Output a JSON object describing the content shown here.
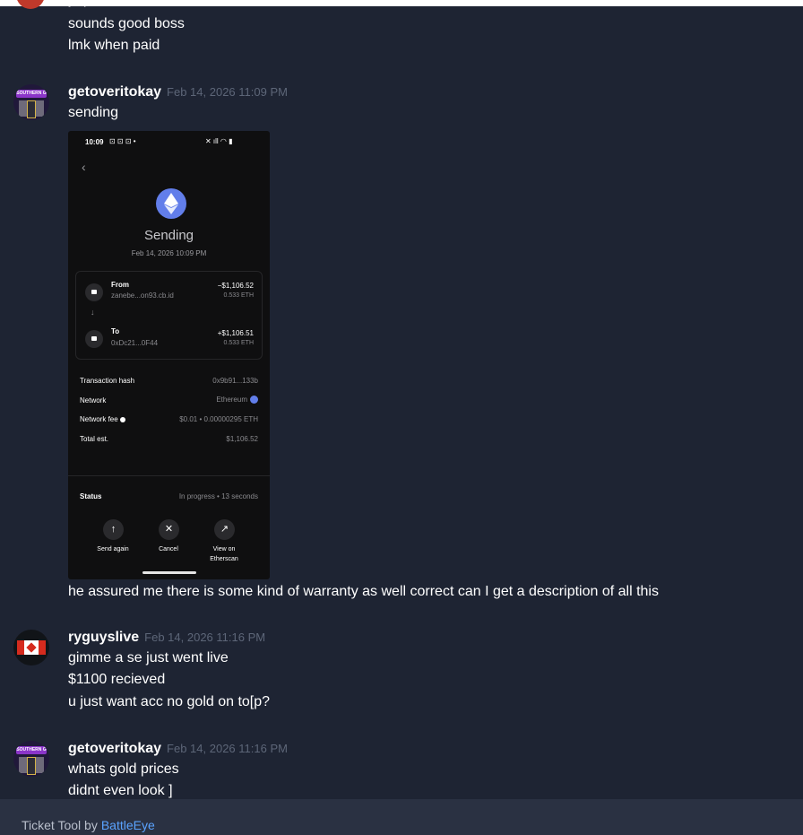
{
  "prev_message": {
    "partial_text": "yep",
    "lines": [
      "sounds good boss",
      "lmk when paid"
    ]
  },
  "messages": [
    {
      "username": "getoveritokay",
      "timestamp": "Feb 14, 2026 11:09 PM",
      "avatar_text": "SOUTHERN G",
      "lines": [
        "sending"
      ],
      "after_image": "he assured me there is some kind of warranty as well correct can I get a description of all this"
    },
    {
      "username": "ryguyslive",
      "timestamp": "Feb 14, 2026 11:16 PM",
      "lines": [
        "gimme a se just went live",
        "$1100 recieved",
        "u just want acc no gold on to[p?"
      ]
    },
    {
      "username": "getoveritokay",
      "timestamp": "Feb 14, 2026 11:16 PM",
      "avatar_text": "SOUTHERN G",
      "lines": [
        "whats gold prices",
        "didnt even look ]"
      ]
    }
  ],
  "attachment": {
    "status_time": "10:09",
    "title": "Sending",
    "date": "Feb 14, 2026 10:09 PM",
    "from": {
      "label": "From",
      "address": "zanebe...on93.cb.id",
      "usd": "−$1,106.52",
      "eth": "0.533 ETH"
    },
    "to": {
      "label": "To",
      "address": "0xDc21...0F44",
      "usd": "+$1,106.51",
      "eth": "0.533 ETH"
    },
    "details": [
      {
        "label": "Transaction hash",
        "value": "0x9b91...133b"
      },
      {
        "label": "Network",
        "value": "Ethereum"
      },
      {
        "label": "Network fee",
        "value": "$0.01 • 0.00000295 ETH"
      },
      {
        "label": "Total est.",
        "value": "$1,106.52"
      }
    ],
    "status_label": "Status",
    "status_value": "In progress • 13 seconds",
    "actions": [
      {
        "label": "Send again",
        "icon": "↑"
      },
      {
        "label": "Cancel",
        "icon": "✕"
      },
      {
        "label": "View on Etherscan",
        "icon": "↗"
      }
    ]
  },
  "footer": {
    "prefix": "Ticket Tool by",
    "link": "BattleEye"
  }
}
